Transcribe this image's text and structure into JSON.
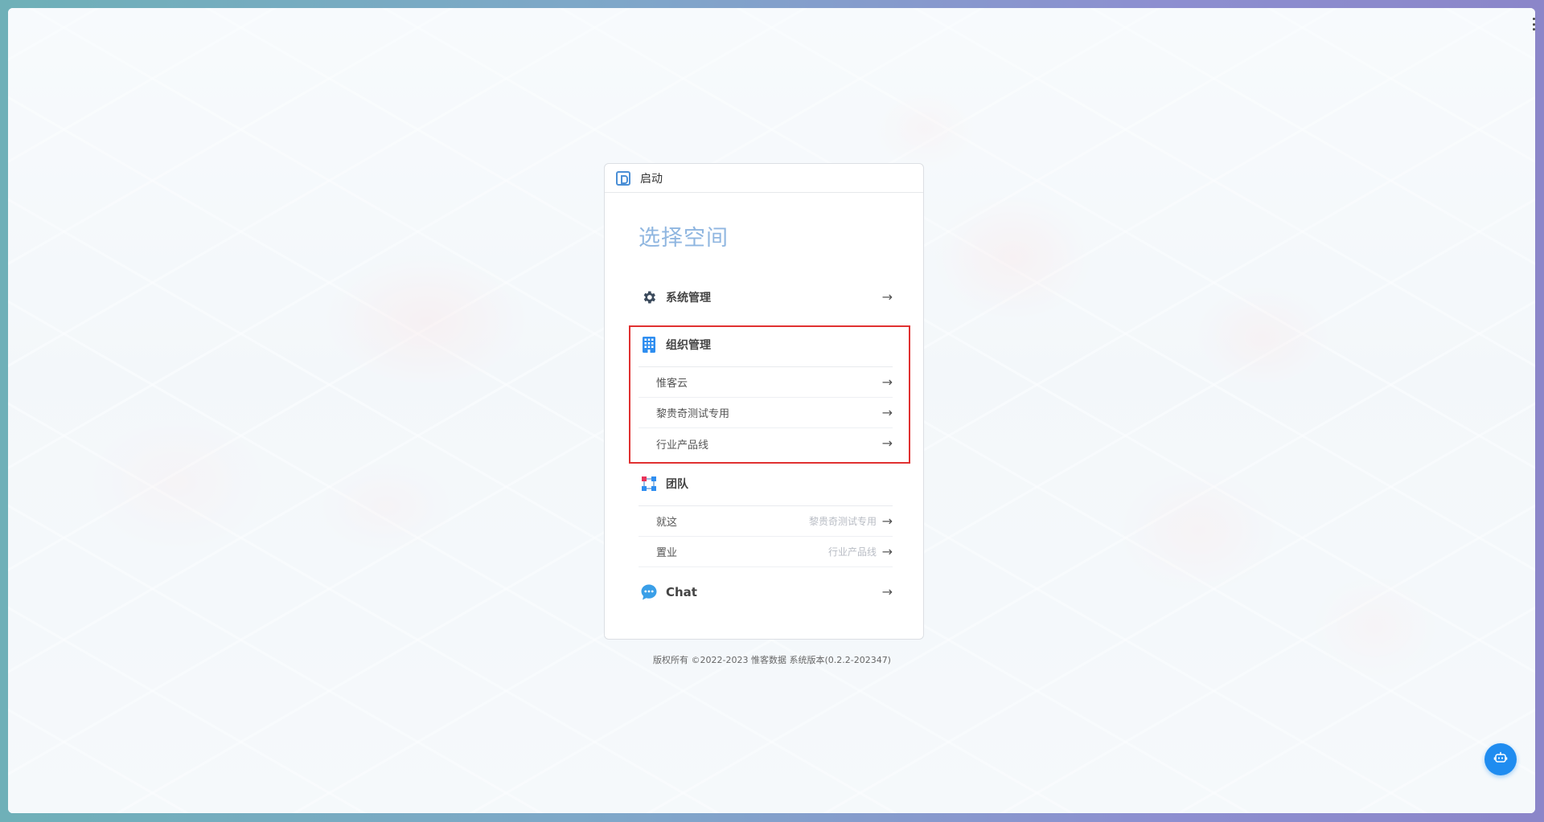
{
  "window": {
    "header_title": "启动"
  },
  "page": {
    "title": "选择空间"
  },
  "sections": {
    "system": {
      "label": "系统管理",
      "icon": "gear-icon",
      "arrow": "→"
    },
    "org": {
      "label": "组织管理",
      "icon": "building-icon",
      "items": [
        {
          "label": "惟客云",
          "arrow": "→"
        },
        {
          "label": "黎贵奇测试专用",
          "arrow": "→"
        },
        {
          "label": "行业产品线",
          "arrow": "→"
        }
      ]
    },
    "team": {
      "label": "团队",
      "icon": "team-icon",
      "items": [
        {
          "label": "就这",
          "hint": "黎贵奇测试专用",
          "arrow": "→"
        },
        {
          "label": "置业",
          "hint": "行业产品线",
          "arrow": "→"
        }
      ]
    },
    "chat": {
      "label": "Chat",
      "icon": "chat-bubble-icon",
      "arrow": "→"
    }
  },
  "footer": {
    "text": "版权所有 ©2022-2023 惟客数据 系统版本(0.2.2-202347)"
  },
  "colors": {
    "accent": "#1f8cf0",
    "highlight_border": "#e03131",
    "title": "#8fb6e0"
  },
  "fab": {
    "icon": "robot-icon"
  }
}
